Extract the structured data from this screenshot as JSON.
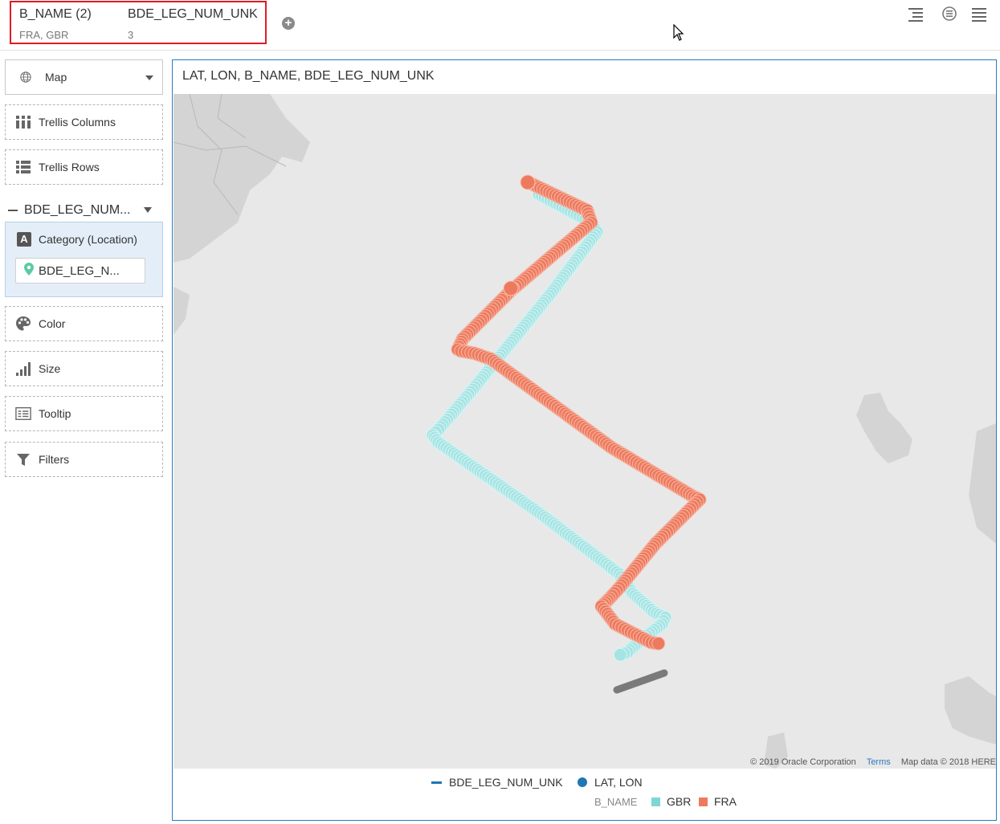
{
  "filter_bar": {
    "filters": [
      {
        "name": "B_NAME (2)",
        "value": "FRA, GBR"
      },
      {
        "name": "BDE_LEG_NUM_UNK",
        "value": "3"
      }
    ],
    "add_icon": "plus-circle-icon",
    "right_icons": [
      "indent-icon",
      "assistant-icon",
      "menu-icon"
    ]
  },
  "left_panel": {
    "viz_type": {
      "label": "Map",
      "icon": "globe-icon"
    },
    "trellis_columns": {
      "label": "Trellis Columns",
      "icon": "columns-icon"
    },
    "trellis_rows": {
      "label": "Trellis Rows",
      "icon": "rows-icon"
    },
    "layer_name": "BDE_LEG_NUM...",
    "category": {
      "label": "Category (Location)",
      "chip": "BDE_LEG_N..."
    },
    "color": {
      "label": "Color",
      "icon": "palette-icon"
    },
    "size": {
      "label": "Size",
      "icon": "size-icon"
    },
    "tooltip": {
      "label": "Tooltip",
      "icon": "tooltip-icon"
    },
    "filters": {
      "label": "Filters",
      "icon": "funnel-icon"
    }
  },
  "viz": {
    "title": "LAT, LON, B_NAME, BDE_LEG_NUM_UNK",
    "attribution": {
      "copyright": "© 2019 Oracle Corporation",
      "terms": "Terms",
      "map_data": "Map data © 2018 HERE"
    },
    "legend": {
      "line_label": "BDE_LEG_NUM_UNK",
      "dot_label": "LAT, LON",
      "color_title": "B_NAME",
      "items": [
        {
          "label": "GBR",
          "color": "#7fd6d6"
        },
        {
          "label": "FRA",
          "color": "#ee7a5e"
        }
      ]
    }
  },
  "colors": {
    "accent_blue": "#2c7bbf",
    "highlight_red": "#e01b24",
    "gbr": "#9ee0e0",
    "fra": "#ee7a5e",
    "line": "#7a7a7a"
  }
}
